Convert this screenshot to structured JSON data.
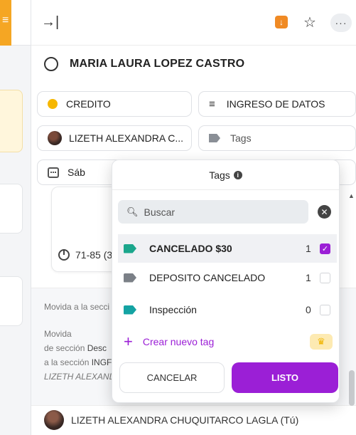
{
  "task": {
    "title": "MARIA LAURA LOPEZ CASTRO"
  },
  "fields": {
    "status": "CREDITO",
    "section": "INGRESO DE DATOS",
    "assignee": "LIZETH ALEXANDRA C...",
    "tags_label": "Tags",
    "date": "Sáb"
  },
  "range_text": "71-85 (3",
  "activity": {
    "line1": "Movida a la secci",
    "line2": "Movida",
    "line3_prefix": "de sección ",
    "line3_bold": "Desc",
    "line4_prefix": "a la sección ",
    "line4_bold": "INGF",
    "line5": "LIZETH ALEXAND"
  },
  "comment": {
    "author": "LIZETH ALEXANDRA CHUQUITARCO LAGLA (Tú)"
  },
  "popup": {
    "title": "Tags",
    "search_placeholder": "Buscar",
    "tags": [
      {
        "name": "CANCELADO $30",
        "count": "1",
        "checked": true,
        "color": "#1ba68c"
      },
      {
        "name": "DEPOSITO CANCELADO",
        "count": "1",
        "checked": false,
        "color": "#7b8087"
      },
      {
        "name": "Inspección",
        "count": "0",
        "checked": false,
        "color": "#14a3a3"
      }
    ],
    "create_label": "Crear nuevo tag",
    "cancel_label": "CANCELAR",
    "ok_label": "LISTO"
  },
  "colors": {
    "accent": "#9b1fd6",
    "status_yellow": "#f6b700",
    "download_orange": "#f08a24"
  },
  "icons": [
    "collapse-icon",
    "download-icon",
    "star-icon",
    "more-icon",
    "search-icon",
    "clear-icon",
    "crown-icon",
    "info-icon"
  ]
}
